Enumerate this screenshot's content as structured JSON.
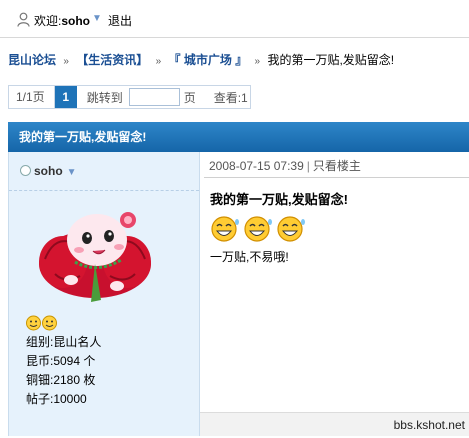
{
  "topbar": {
    "welcome_prefix": "欢迎:",
    "username": "soho",
    "logout": "退出"
  },
  "breadcrumb": {
    "items": [
      "昆山论坛",
      "【生活资讯】",
      "『 城市广场 』"
    ],
    "current": "我的第一万贴,发贴留念!",
    "separator": "»"
  },
  "pager": {
    "page_info": "1/1页",
    "current_page": "1",
    "jump_label": "跳转到",
    "jump_value": "",
    "unit": "页",
    "view": "查看:1"
  },
  "thread": {
    "title": "我的第一万贴,发贴留念!"
  },
  "author": {
    "name": "soho",
    "group": "组别:昆山名人",
    "coins": "昆币:5094 个",
    "copper": "铜钿:2180 枚",
    "posts": "帖子:10000"
  },
  "post": {
    "datetime": "2008-07-15 07:39",
    "only_author": "只看楼主",
    "title": "我的第一万贴,发贴留念!",
    "body": "一万贴,不易哦!"
  },
  "watermark": "bbs.kshot.net",
  "colors": {
    "link": "#1b4f93",
    "title_bar": "#1e73b8",
    "left_panel": "#e6f2fc"
  }
}
